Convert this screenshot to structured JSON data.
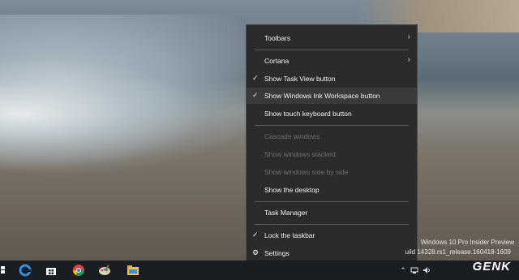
{
  "menu": {
    "items": [
      {
        "label": "Toolbars",
        "checked": false,
        "submenu": true,
        "disabled": false,
        "hover": false
      },
      {
        "label": "Cortana",
        "checked": false,
        "submenu": true,
        "disabled": false,
        "hover": false
      },
      {
        "label": "Show Task View button",
        "checked": true,
        "submenu": false,
        "disabled": false,
        "hover": false
      },
      {
        "label": "Show Windows Ink Workspace button",
        "checked": true,
        "submenu": false,
        "disabled": false,
        "hover": true
      },
      {
        "label": "Show touch keyboard button",
        "checked": false,
        "submenu": false,
        "disabled": false,
        "hover": false
      },
      {
        "label": "Cascade windows",
        "checked": false,
        "submenu": false,
        "disabled": true,
        "hover": false
      },
      {
        "label": "Show windows stacked",
        "checked": false,
        "submenu": false,
        "disabled": true,
        "hover": false
      },
      {
        "label": "Show windows side by side",
        "checked": false,
        "submenu": false,
        "disabled": true,
        "hover": false
      },
      {
        "label": "Show the desktop",
        "checked": false,
        "submenu": false,
        "disabled": false,
        "hover": false
      },
      {
        "label": "Task Manager",
        "checked": false,
        "submenu": false,
        "disabled": false,
        "hover": false
      },
      {
        "label": "Lock the taskbar",
        "checked": true,
        "submenu": false,
        "disabled": false,
        "hover": false
      },
      {
        "label": "Settings",
        "checked": false,
        "submenu": false,
        "disabled": false,
        "hover": false,
        "icon": "gear-icon"
      }
    ]
  },
  "watermark": {
    "line1": "Windows 10 Pro Insider Preview",
    "line2": "uild 14328.rs1_release.160418-1609"
  },
  "brand": "GENK",
  "taskbar": {
    "icons": [
      "windows-start-icon",
      "edge-icon",
      "store-icon",
      "chrome-icon",
      "paint-icon",
      "file-explorer-icon"
    ],
    "tray": [
      "chevron-up-icon",
      "network-icon",
      "volume-icon"
    ]
  },
  "colors": {
    "menu_bg": "#2b2b2b",
    "hover": "#3a3a3a",
    "taskbar": "#1a1d22",
    "disabled": "#6e6e6e"
  }
}
